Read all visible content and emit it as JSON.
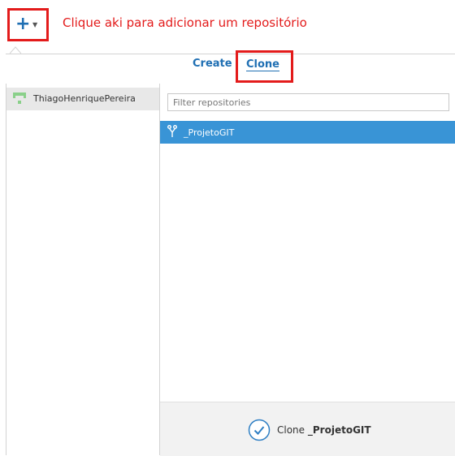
{
  "toolbar": {
    "add_icon": "plus-icon",
    "caret_icon": "caret-down-icon",
    "annotation": "Clique aki para adicionar um repositório"
  },
  "tabs": [
    {
      "label": "Create",
      "active": false
    },
    {
      "label": "Clone",
      "active": true
    }
  ],
  "sidebar": {
    "accounts": [
      {
        "name": "ThiagoHenriquePereira",
        "selected": true
      }
    ]
  },
  "filter": {
    "placeholder": "Filter repositories",
    "value": ""
  },
  "repositories": [
    {
      "name": "_ProjetoGIT",
      "icon": "fork-icon",
      "selected": true
    }
  ],
  "action": {
    "prefix": "Clone",
    "repo": "_ProjetoGIT",
    "icon": "check-circle-icon"
  },
  "colors": {
    "accent": "#1f6fb3",
    "selection": "#3994d6",
    "annotation_red": "#e31b1b"
  }
}
